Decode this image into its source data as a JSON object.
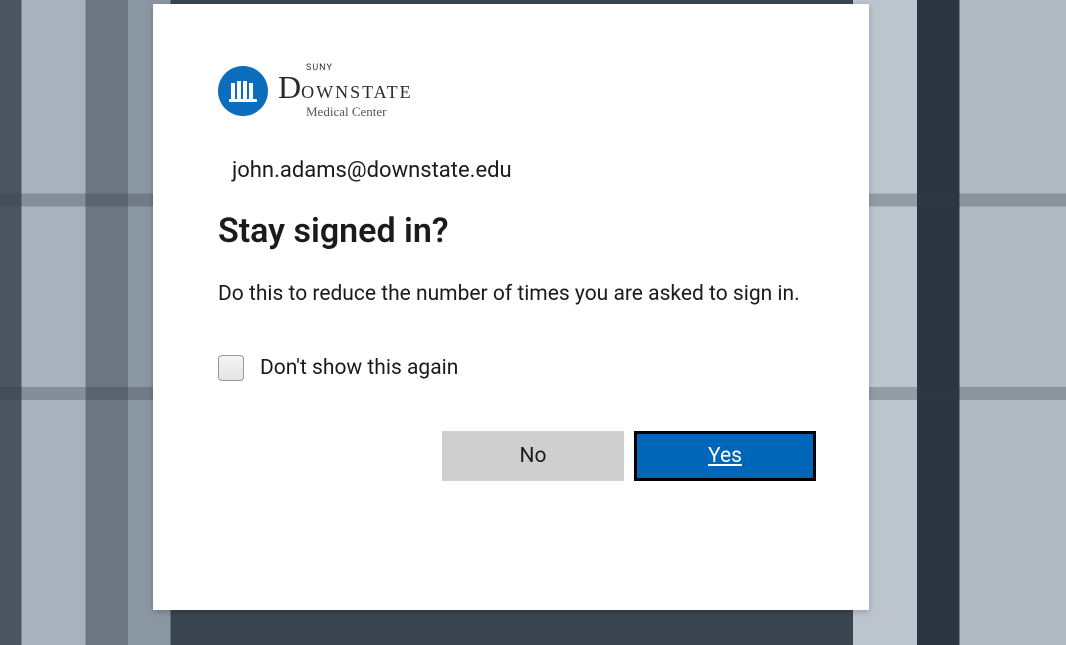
{
  "logo": {
    "suny": "SUNY",
    "main_prefix": "D",
    "main_rest": "OWNSTATE",
    "sub": "Medical Center"
  },
  "email": "john.adams@downstate.edu",
  "heading": "Stay signed in?",
  "description": "Do this to reduce the number of times you are asked to sign in.",
  "checkbox_label": "Don't show this again",
  "buttons": {
    "no": "No",
    "yes": "Yes"
  }
}
